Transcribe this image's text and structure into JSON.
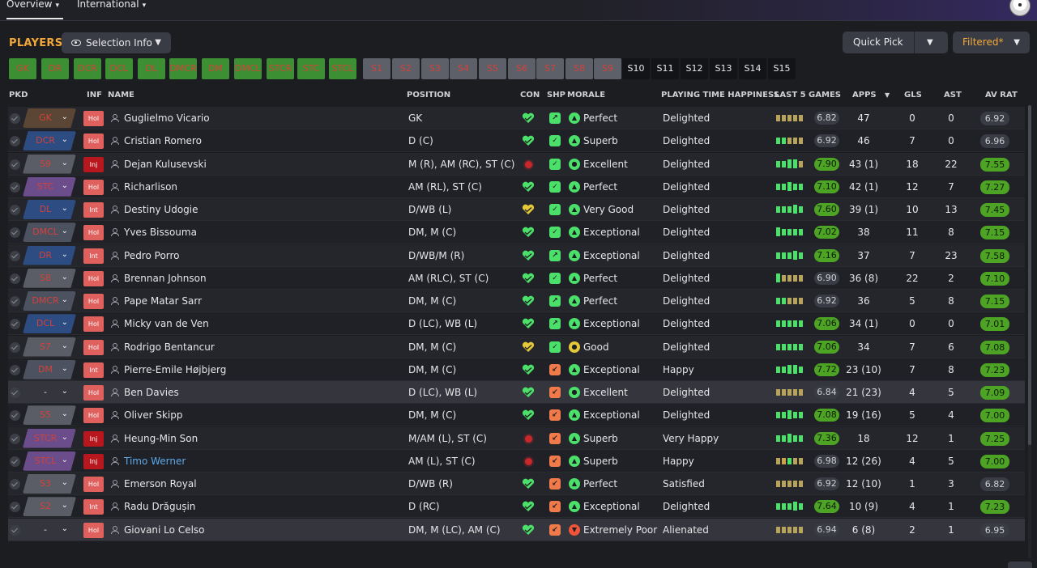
{
  "tabs": [
    {
      "label": "Overview"
    },
    {
      "label": "International"
    }
  ],
  "header": {
    "title": "PLAYERS",
    "selection_info": "Selection Info",
    "quick_pick": "Quick Pick",
    "filtered": "Filtered*"
  },
  "selection_strip": [
    {
      "label": "GK",
      "style": "green"
    },
    {
      "label": "DR",
      "style": "green"
    },
    {
      "label": "DCR",
      "style": "green"
    },
    {
      "label": "DCL",
      "style": "green"
    },
    {
      "label": "DL",
      "style": "green"
    },
    {
      "label": "DMCR",
      "style": "green"
    },
    {
      "label": "DM",
      "style": "green"
    },
    {
      "label": "DMCL",
      "style": "green"
    },
    {
      "label": "STCR",
      "style": "green"
    },
    {
      "label": "STC",
      "style": "green"
    },
    {
      "label": "STCL",
      "style": "green"
    },
    {
      "label": "S1",
      "style": "gray"
    },
    {
      "label": "S2",
      "style": "gray"
    },
    {
      "label": "S3",
      "style": "gray"
    },
    {
      "label": "S4",
      "style": "gray"
    },
    {
      "label": "S5",
      "style": "gray"
    },
    {
      "label": "S6",
      "style": "gray"
    },
    {
      "label": "S7",
      "style": "gray"
    },
    {
      "label": "S8",
      "style": "gray"
    },
    {
      "label": "S9",
      "style": "gray"
    },
    {
      "label": "S10",
      "style": "dark"
    },
    {
      "label": "S11",
      "style": "dark"
    },
    {
      "label": "S12",
      "style": "dark"
    },
    {
      "label": "S13",
      "style": "dark"
    },
    {
      "label": "S14",
      "style": "dark"
    },
    {
      "label": "S15",
      "style": "dark"
    }
  ],
  "columns": {
    "pkd": "PKD",
    "inf": "INF",
    "name": "NAME",
    "position": "POSITION",
    "con": "CON",
    "shp": "SHP",
    "morale": "MORALE",
    "pth": "PLAYING TIME HAPPINESS",
    "last5": "LAST 5 GAMES",
    "apps": "APPS",
    "gls": "GLS",
    "ast": "AST",
    "avrat": "AV RAT"
  },
  "colors": {
    "accent": "#f3a83a",
    "green_rating": "#4ca324",
    "gk_pick": "#5b4636",
    "def_pick": "#2d4d82",
    "mid_pick": "#4d5260",
    "att_pick": "#6a4d8a",
    "sub_pick": "#5a5d66"
  },
  "players": [
    {
      "pick": "GK",
      "pick_group": "gk",
      "inf": "Hol",
      "name": "Guglielmo Vicario",
      "position": "GK",
      "con": "heart",
      "con_color": "#4be06a",
      "shp": "up",
      "shp_color": "#4be06a",
      "morale_icon": "up",
      "morale_color": "#4be06a",
      "morale": "Perfect",
      "pth": "Delighted",
      "form": [
        "y",
        "y",
        "y",
        "y",
        "y"
      ],
      "last5": "6.82",
      "last5_style": "gray",
      "apps": "47",
      "gls": "0",
      "ast": "0",
      "avrat": "6.92",
      "av_style": "gray"
    },
    {
      "pick": "DCR",
      "pick_group": "def",
      "inf": "Hol",
      "name": "Cristian Romero",
      "position": "D (C)",
      "con": "heart",
      "con_color": "#4be06a",
      "shp": "check",
      "shp_color": "#4be06a",
      "morale_icon": "up",
      "morale_color": "#4be06a",
      "morale": "Superb",
      "pth": "Delighted",
      "form": [
        "g",
        "g",
        "y",
        "y",
        "y"
      ],
      "last5": "6.92",
      "last5_style": "gray",
      "apps": "46",
      "gls": "7",
      "ast": "0",
      "avrat": "6.96",
      "av_style": "gray"
    },
    {
      "pick": "S9",
      "pick_group": "sub",
      "inf": "Inj",
      "name": "Dejan Kulusevski",
      "position": "M (R), AM (RC), ST (C)",
      "con": "dot",
      "con_color": "#c9282a",
      "shp": "check",
      "shp_color": "#4be06a",
      "morale_icon": "ok",
      "morale_color": "#4be06a",
      "morale": "Excellent",
      "pth": "Delighted",
      "form": [
        "g",
        "g",
        "G",
        "G",
        "y"
      ],
      "last5": "7.90",
      "last5_style": "green",
      "apps": "43 (1)",
      "gls": "18",
      "ast": "22",
      "avrat": "7.55",
      "av_style": "green"
    },
    {
      "pick": "STC",
      "pick_group": "att",
      "inf": "Hol",
      "name": "Richarlison",
      "position": "AM (RL), ST (C)",
      "con": "heart",
      "con_color": "#4be06a",
      "shp": "check",
      "shp_color": "#4be06a",
      "morale_icon": "up",
      "morale_color": "#4be06a",
      "morale": "Perfect",
      "pth": "Delighted",
      "form": [
        "g",
        "g",
        "G",
        "g",
        "g"
      ],
      "last5": "7.10",
      "last5_style": "green",
      "apps": "42 (1)",
      "gls": "12",
      "ast": "7",
      "avrat": "7.27",
      "av_style": "green"
    },
    {
      "pick": "DL",
      "pick_group": "def",
      "inf": "Int",
      "name": "Destiny Udogie",
      "position": "D/WB (L)",
      "con": "heart",
      "con_color": "#e3c83a",
      "shp": "check",
      "shp_color": "#4be06a",
      "morale_icon": "up",
      "morale_color": "#4be06a",
      "morale": "Very Good",
      "pth": "Delighted",
      "form": [
        "g",
        "g",
        "g",
        "G",
        "g"
      ],
      "last5": "7.60",
      "last5_style": "green",
      "apps": "39 (1)",
      "gls": "10",
      "ast": "13",
      "avrat": "7.45",
      "av_style": "green"
    },
    {
      "pick": "DMCL",
      "pick_group": "mid",
      "inf": "Hol",
      "name": "Yves Bissouma",
      "position": "DM, M (C)",
      "con": "heart",
      "con_color": "#4be06a",
      "shp": "check",
      "shp_color": "#4be06a",
      "morale_icon": "up",
      "morale_color": "#4be06a",
      "morale": "Exceptional",
      "pth": "Delighted",
      "form": [
        "G",
        "g",
        "g",
        "g",
        "g"
      ],
      "last5": "7.02",
      "last5_style": "green",
      "apps": "38",
      "gls": "11",
      "ast": "8",
      "avrat": "7.15",
      "av_style": "green"
    },
    {
      "pick": "DR",
      "pick_group": "def",
      "inf": "Int",
      "name": "Pedro Porro",
      "position": "D/WB/M (R)",
      "con": "heart",
      "con_color": "#4be06a",
      "shp": "up",
      "shp_color": "#4be06a",
      "morale_icon": "up",
      "morale_color": "#4be06a",
      "morale": "Exceptional",
      "pth": "Delighted",
      "form": [
        "g",
        "g",
        "g",
        "G",
        "g"
      ],
      "last5": "7.16",
      "last5_style": "green",
      "apps": "37",
      "gls": "7",
      "ast": "23",
      "avrat": "7.58",
      "av_style": "green"
    },
    {
      "pick": "S8",
      "pick_group": "sub",
      "inf": "Hol",
      "name": "Brennan Johnson",
      "position": "AM (RLC), ST (C)",
      "con": "heart",
      "con_color": "#4be06a",
      "shp": "check",
      "shp_color": "#4be06a",
      "morale_icon": "up",
      "morale_color": "#4be06a",
      "morale": "Perfect",
      "pth": "Delighted",
      "form": [
        "G",
        "y",
        "y",
        "y",
        "y"
      ],
      "last5": "6.90",
      "last5_style": "gray",
      "apps": "36 (8)",
      "gls": "22",
      "ast": "2",
      "avrat": "7.10",
      "av_style": "green"
    },
    {
      "pick": "DMCR",
      "pick_group": "mid",
      "inf": "Hol",
      "name": "Pape Matar Sarr",
      "position": "DM, M (C)",
      "con": "heart",
      "con_color": "#4be06a",
      "shp": "up",
      "shp_color": "#4be06a",
      "morale_icon": "up",
      "morale_color": "#4be06a",
      "morale": "Perfect",
      "pth": "Delighted",
      "form": [
        "g",
        "g",
        "y",
        "y",
        "y"
      ],
      "last5": "6.92",
      "last5_style": "gray",
      "apps": "36",
      "gls": "5",
      "ast": "8",
      "avrat": "7.15",
      "av_style": "green"
    },
    {
      "pick": "DCL",
      "pick_group": "def",
      "inf": "Hol",
      "name": "Micky van de Ven",
      "position": "D (LC), WB (L)",
      "con": "heart",
      "con_color": "#4be06a",
      "shp": "up",
      "shp_color": "#4be06a",
      "morale_icon": "up",
      "morale_color": "#4be06a",
      "morale": "Exceptional",
      "pth": "Delighted",
      "form": [
        "g",
        "g",
        "g",
        "g",
        "g"
      ],
      "last5": "7.06",
      "last5_style": "green",
      "apps": "34 (1)",
      "gls": "0",
      "ast": "0",
      "avrat": "7.01",
      "av_style": "green"
    },
    {
      "pick": "S7",
      "pick_group": "sub",
      "inf": "Hol",
      "name": "Rodrigo Bentancur",
      "position": "DM, M (C)",
      "con": "heart",
      "con_color": "#e3c83a",
      "shp": "check",
      "shp_color": "#4be06a",
      "morale_icon": "ok",
      "morale_color": "#e3c83a",
      "morale": "Good",
      "pth": "Delighted",
      "form": [
        "g",
        "g",
        "g",
        "g",
        "g"
      ],
      "last5": "7.06",
      "last5_style": "green",
      "apps": "34",
      "gls": "7",
      "ast": "6",
      "avrat": "7.08",
      "av_style": "green"
    },
    {
      "pick": "DM",
      "pick_group": "mid",
      "inf": "Int",
      "name": "Pierre-Emile Højbjerg",
      "position": "DM, M (C)",
      "con": "heart",
      "con_color": "#4be06a",
      "shp": "down",
      "shp_color": "#f07a4a",
      "morale_icon": "up",
      "morale_color": "#4be06a",
      "morale": "Exceptional",
      "pth": "Happy",
      "form": [
        "g",
        "g",
        "G",
        "G",
        "g"
      ],
      "last5": "7.72",
      "last5_style": "green",
      "apps": "23 (10)",
      "gls": "7",
      "ast": "8",
      "avrat": "7.23",
      "av_style": "green"
    },
    {
      "pick": "-",
      "pick_group": "blank",
      "inf": "Hol",
      "name": "Ben Davies",
      "position": "D (LC), WB (L)",
      "con": "heart",
      "con_color": "#4be06a",
      "shp": "down",
      "shp_color": "#f07a4a",
      "morale_icon": "ok",
      "morale_color": "#4be06a",
      "morale": "Excellent",
      "pth": "Delighted",
      "form": [
        "y",
        "y",
        "y",
        "y",
        "y"
      ],
      "last5": "6.84",
      "last5_style": "gray",
      "apps": "21 (23)",
      "gls": "4",
      "ast": "5",
      "avrat": "7.09",
      "av_style": "green"
    },
    {
      "pick": "S5",
      "pick_group": "sub",
      "inf": "Hol",
      "name": "Oliver Skipp",
      "position": "DM, M (C)",
      "con": "heart",
      "con_color": "#4be06a",
      "shp": "down",
      "shp_color": "#f07a4a",
      "morale_icon": "up",
      "morale_color": "#4be06a",
      "morale": "Exceptional",
      "pth": "Delighted",
      "form": [
        "g",
        "g",
        "G",
        "g",
        "g"
      ],
      "last5": "7.08",
      "last5_style": "green",
      "apps": "19 (16)",
      "gls": "5",
      "ast": "4",
      "avrat": "7.00",
      "av_style": "green"
    },
    {
      "pick": "STCR",
      "pick_group": "att",
      "inf": "Inj",
      "name": "Heung-Min Son",
      "position": "M/AM (L), ST (C)",
      "con": "dot",
      "con_color": "#c9282a",
      "shp": "down",
      "shp_color": "#f07a4a",
      "morale_icon": "up",
      "morale_color": "#4be06a",
      "morale": "Superb",
      "pth": "Very Happy",
      "form": [
        "g",
        "g",
        "G",
        "g",
        "g"
      ],
      "last5": "7.36",
      "last5_style": "green",
      "apps": "18",
      "gls": "12",
      "ast": "1",
      "avrat": "7.25",
      "av_style": "green"
    },
    {
      "pick": "STCL",
      "pick_group": "att",
      "inf": "Inj",
      "name": "Timo Werner",
      "name_link": true,
      "position": "AM (L), ST (C)",
      "con": "dot",
      "con_color": "#c9282a",
      "shp": "down",
      "shp_color": "#f07a4a",
      "morale_icon": "up",
      "morale_color": "#4be06a",
      "morale": "Superb",
      "pth": "Happy",
      "form": [
        "y",
        "o",
        "g",
        "y",
        "y"
      ],
      "last5": "6.98",
      "last5_style": "gray",
      "apps": "12 (26)",
      "gls": "4",
      "ast": "5",
      "avrat": "7.00",
      "av_style": "green"
    },
    {
      "pick": "S3",
      "pick_group": "sub",
      "inf": "Hol",
      "name": "Emerson Royal",
      "position": "D/WB (R)",
      "con": "heart",
      "con_color": "#4be06a",
      "shp": "down",
      "shp_color": "#f07a4a",
      "morale_icon": "up",
      "morale_color": "#4be06a",
      "morale": "Perfect",
      "pth": "Satisfied",
      "form": [
        "y",
        "y",
        "y",
        "y",
        "y"
      ],
      "last5": "6.92",
      "last5_style": "gray",
      "apps": "12 (10)",
      "gls": "1",
      "ast": "3",
      "avrat": "6.82",
      "av_style": "gray"
    },
    {
      "pick": "S2",
      "pick_group": "sub",
      "inf": "Int",
      "name": "Radu Drăgușin",
      "position": "D (RC)",
      "con": "heart",
      "con_color": "#4be06a",
      "shp": "down",
      "shp_color": "#f07a4a",
      "morale_icon": "up",
      "morale_color": "#4be06a",
      "morale": "Exceptional",
      "pth": "Delighted",
      "form": [
        "g",
        "g",
        "g",
        "G",
        "g"
      ],
      "last5": "7.64",
      "last5_style": "green",
      "apps": "10 (9)",
      "gls": "4",
      "ast": "1",
      "avrat": "7.23",
      "av_style": "green"
    },
    {
      "pick": "-",
      "pick_group": "blank",
      "inf": "Hol",
      "name": "Giovani Lo Celso",
      "position": "DM, M (LC), AM (C)",
      "con": "heart",
      "con_color": "#4be06a",
      "shp": "down",
      "shp_color": "#f07a4a",
      "morale_icon": "down",
      "morale_color": "#f0553a",
      "morale": "Extremely Poor",
      "pth": "Alienated",
      "form": [
        "y",
        "y",
        "y",
        "y",
        "y"
      ],
      "last5": "6.94",
      "last5_style": "gray",
      "apps": "6 (8)",
      "gls": "2",
      "ast": "1",
      "avrat": "6.95",
      "av_style": "gray"
    }
  ]
}
